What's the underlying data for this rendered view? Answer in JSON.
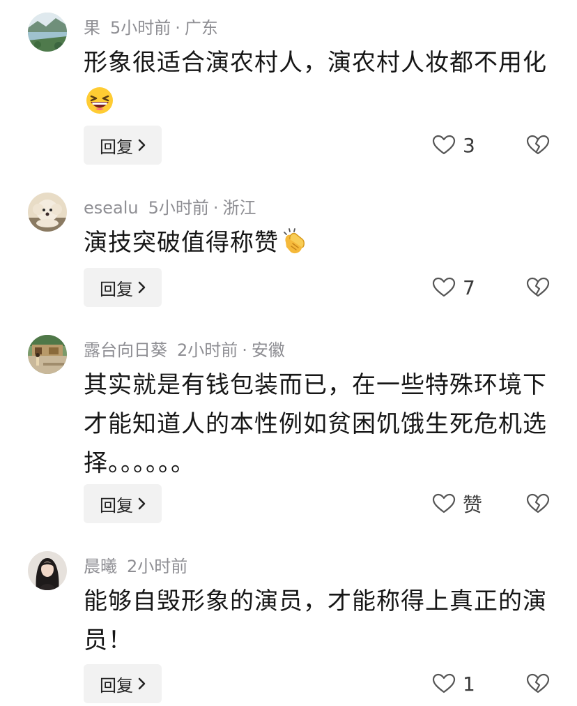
{
  "comments": [
    {
      "username": "果",
      "time": "5小时前",
      "location": "广东",
      "text": "形象很适合演农村人，演农村人妆都不用化",
      "emoji": "grinning-squinting-face",
      "reply_label": "回复",
      "likes": "3"
    },
    {
      "username": "esealu",
      "time": "5小时前",
      "location": "浙江",
      "text": "演技突破值得称赞",
      "emoji": "clapping-hands",
      "reply_label": "回复",
      "likes": "7"
    },
    {
      "username": "露台向日葵",
      "time": "2小时前",
      "location": "安徽",
      "text": "其实就是有钱包装而已，在一些特殊环境下才能知道人的本性例如贫困饥饿生死危机选择。。。。。。",
      "reply_label": "回复",
      "likes": "赞"
    },
    {
      "username": "晨曦",
      "time": "2小时前",
      "location": "",
      "text": "能够自毁形象的演员，才能称得上真正的演员！",
      "reply_label": "回复",
      "likes": "1"
    }
  ],
  "separator": "·",
  "icons": {
    "like": "heart-outline-icon",
    "dislike": "broken-heart-outline-icon",
    "reply_chevron": "chevron-right-icon"
  },
  "colors": {
    "meta_text": "#8e8e93",
    "body_text": "#161616",
    "reply_bg": "#f2f2f2",
    "icon_stroke": "#555555"
  }
}
